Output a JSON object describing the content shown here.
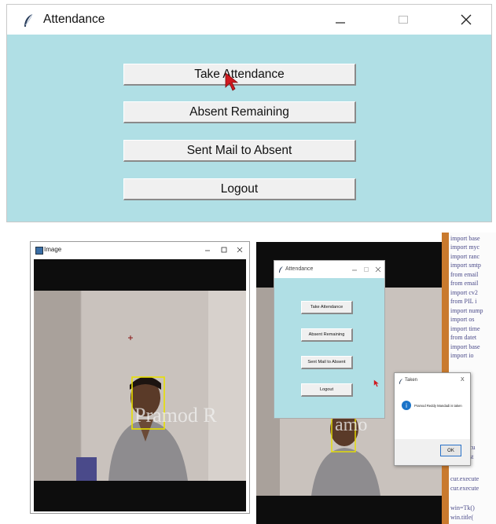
{
  "top_window": {
    "title": "Attendance",
    "buttons": [
      {
        "label": "Take Attendance"
      },
      {
        "label": "Absent Remaining"
      },
      {
        "label": "Sent Mail to Absent"
      },
      {
        "label": "Logout"
      }
    ]
  },
  "image_window": {
    "title": "Image",
    "overlay_text": "Pramod R"
  },
  "second_screenshot": {
    "window": {
      "title": "Attendance",
      "buttons": [
        {
          "label": "Take Attendance"
        },
        {
          "label": "Absent Remaining"
        },
        {
          "label": "Sent Mail to Absent"
        },
        {
          "label": "Logout"
        }
      ]
    },
    "overlay_text": "amo",
    "code_lines": [
      "import base",
      "import myc",
      "import ranc",
      "import smtp",
      "from email",
      "from email",
      "import cv2",
      "from PIL i",
      "import nump",
      "import os",
      "import time",
      "from datet",
      "import base",
      "import io"
    ],
    "code_bottom": [
      "cu",
      "st",
      "cur.execute",
      "cur.execute"
    ],
    "code_tail": [
      "win=Tk()",
      "win.title("
    ],
    "dialog": {
      "title": "Taken",
      "message": "Pramod Reddy Mandadi is taken",
      "ok_label": "OK",
      "info_glyph": "i",
      "close_glyph": "X"
    }
  },
  "colors": {
    "tk_background": "#b0dfe5",
    "button_face": "#f0f0f0",
    "face_box": "#e8e000",
    "info_blue": "#1a73c8"
  }
}
